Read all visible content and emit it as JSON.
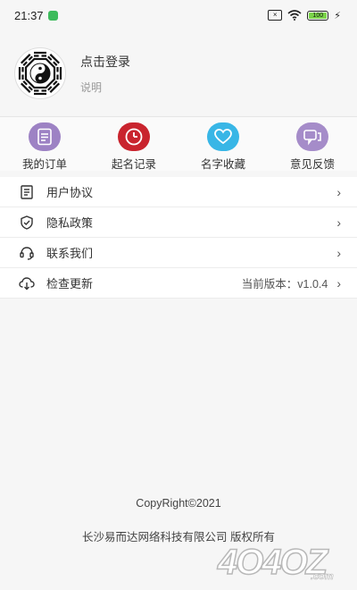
{
  "status_bar": {
    "time": "21:37",
    "battery": "100"
  },
  "profile": {
    "login_text": "点击登录",
    "description": "说明"
  },
  "shortcuts": [
    {
      "label": "我的订单",
      "icon": "document-icon",
      "color": "#9d82c4"
    },
    {
      "label": "起名记录",
      "icon": "clock-icon",
      "color": "#c9242e"
    },
    {
      "label": "名字收藏",
      "icon": "heart-icon",
      "color": "#38b6e6"
    },
    {
      "label": "意见反馈",
      "icon": "chat-icon",
      "color": "#a58cc9"
    }
  ],
  "menu": [
    {
      "label": "用户协议",
      "icon": "document-list-icon",
      "value": ""
    },
    {
      "label": "隐私政策",
      "icon": "shield-check-icon",
      "value": ""
    },
    {
      "label": "联系我们",
      "icon": "headset-icon",
      "value": ""
    },
    {
      "label": "检查更新",
      "icon": "cloud-download-icon",
      "value": "当前版本：v1.0.4"
    }
  ],
  "footer": {
    "copyright": "CopyRight©2021",
    "company": "长沙易而达网络科技有限公司 版权所有"
  },
  "watermark": {
    "text": "4O4OZ.com"
  }
}
